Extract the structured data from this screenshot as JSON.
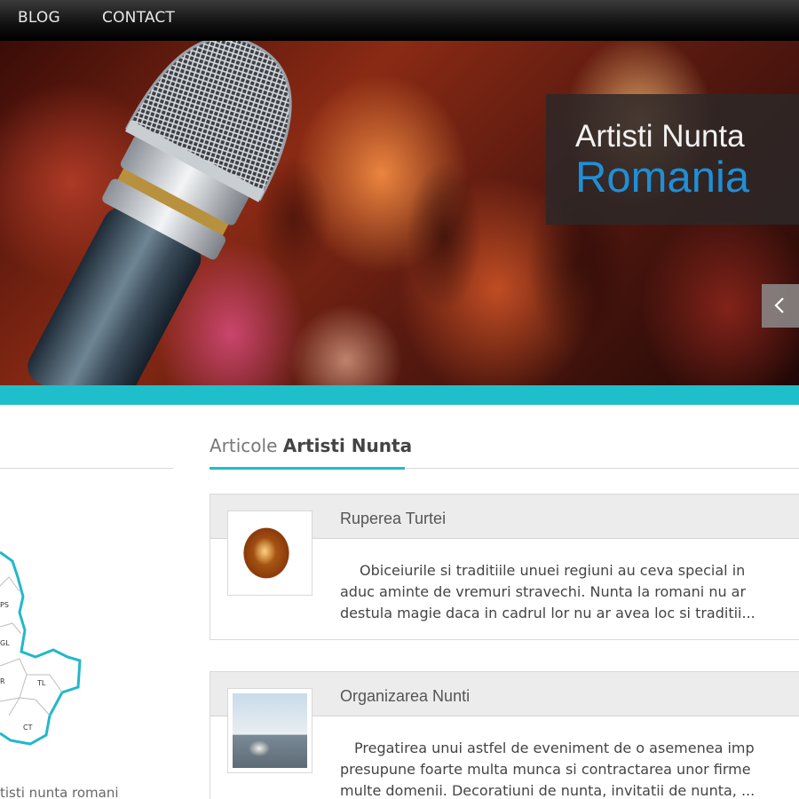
{
  "nav": {
    "items": [
      {
        "label": "BLOG"
      },
      {
        "label": "CONTACT"
      }
    ]
  },
  "hero": {
    "caption_line1": "Artisti Nunta",
    "caption_line2": "Romania",
    "prev_icon": "chevron-left-icon"
  },
  "colors": {
    "accent": "#1ebfca",
    "caption_blue": "#1f8fd6",
    "nav_bg": "#111111"
  },
  "sidebar": {
    "map_labels": [
      "PS",
      "GL",
      "R",
      "TL",
      "CT"
    ],
    "text_snippet": "tisti  nunta  romani"
  },
  "section": {
    "heading_light": "Articole",
    "heading_strong": "Artisti Nunta"
  },
  "articles": [
    {
      "title": "Ruperea Turtei",
      "lines": [
        "Obiceiurile si traditiile unuei regiuni au ceva special in",
        "aduc aminte de vremuri stravechi. Nunta la romani nu ar",
        "destula magie daca in cadrul lor nu ar avea loc si traditii..."
      ]
    },
    {
      "title": "Organizarea Nunti",
      "lines": [
        "Pregatirea unui astfel de eveniment de o asemenea imp",
        "presupune foarte multa munca si contractarea unor firme",
        "multe domenii. Decoratiuni de nunta, invitatii de nunta, ..."
      ]
    }
  ]
}
